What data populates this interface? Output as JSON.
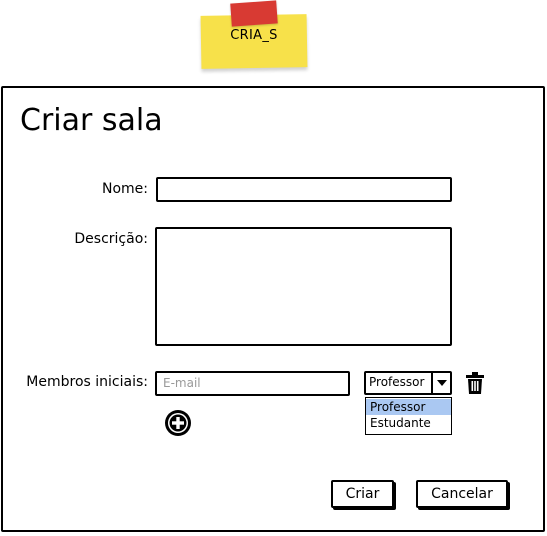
{
  "note": {
    "label": "CRIA_S"
  },
  "dialog": {
    "title": "Criar sala",
    "fields": {
      "nome_label": "Nome:",
      "descricao_label": "Descrição:",
      "membros_label": "Membros iniciais:",
      "email_placeholder": "E-mail"
    },
    "role_select": {
      "value": "Professor",
      "options": [
        "Professor",
        "Estudante"
      ]
    },
    "buttons": {
      "criar": "Criar",
      "cancelar": "Cancelar"
    }
  },
  "colors": {
    "note_yellow": "#f7e14a",
    "tape_red": "#d83a33",
    "selected_option": "#aac8f2"
  },
  "icons": {
    "delete": "trash-icon",
    "add_member": "plus-circle-icon",
    "dropdown": "chevron-down-icon"
  }
}
